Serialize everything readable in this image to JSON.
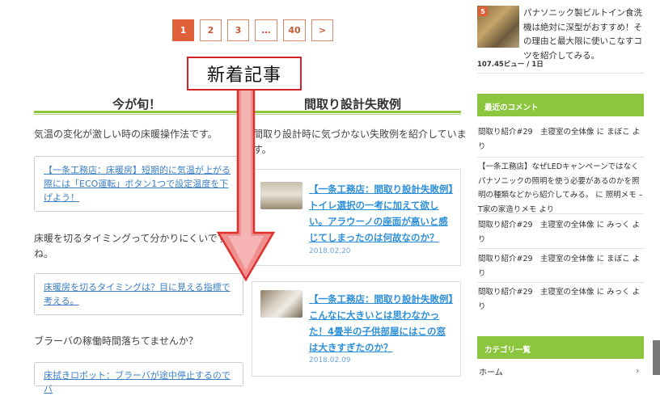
{
  "pagination": {
    "pages": [
      "1",
      "2",
      "3",
      "…",
      "40",
      ">"
    ],
    "active": "1"
  },
  "callout": "新着記事",
  "left_column": {
    "title": "今が旬！",
    "intro": "気温の変化が激しい時の床暖操作法です。",
    "link1": "【一条工務店：床暖房】短期的に気温が上がる際には「ECO運転」ボタン1つで設定温度を下げよう！",
    "text2_line1": "床暖を切るタイミングって分かりにくいですよ",
    "text2_line2": "ね。",
    "link2": "床暖房を切るタイミングは？目に見える指標で考える。",
    "text3": "ブラーバの稼働時間落ちてませんか？",
    "link3": "床拭きロボット：ブラーバが途中停止するのでバ"
  },
  "right_column": {
    "title": "間取り設計失敗例",
    "intro_line1": "間取り設計時に気づかない失敗例を紹介していま",
    "intro_line2": "す。",
    "cards": [
      {
        "title": "【一条工務店：間取り設計失敗例】トイレ選択の一考に加えて欲しい。アラウーノの座面が高いと感じてしまったのは何故なのか？",
        "date": "2018.02.20"
      },
      {
        "title": "【一条工務店：間取り設計失敗例】こんなに大きいとは思わなかった！4畳半の子供部屋にはこの窓は大きすぎたのか？",
        "date": "2018.02.09"
      }
    ]
  },
  "sidebar": {
    "rank_badge": "5",
    "popular_post": "パナソニック製ビルトイン食洗機は絶対に深型がおすすめ！その理由と最大限に使いこなすコツを紹介してみる。",
    "views": "107.45ビュー / 1日",
    "recent_comments_title": "最近のコメント",
    "comments": [
      "間取り紹介#29　主寝室の全体像 に まぼこ より",
      "【一条工務店】なぜLEDキャンペーンではなくパナソニックの照明を使う必要があるのかを照明の種類などから紹介してみる。 に 照明メモ – T家の家造りメモ より",
      "間取り紹介#29　主寝室の全体像 に みっく より",
      "間取り紹介#29　主寝室の全体像 に まぼこ より",
      "間取り紹介#29　主寝室の全体像 に みっく より"
    ],
    "categories_title": "カテゴリ一覧",
    "category_first": "ホーム"
  },
  "colors": {
    "accent_orange": "#e0603a",
    "green": "#8cc63f",
    "link_blue": "#2e8fd8",
    "callout_red": "#d3232a"
  }
}
